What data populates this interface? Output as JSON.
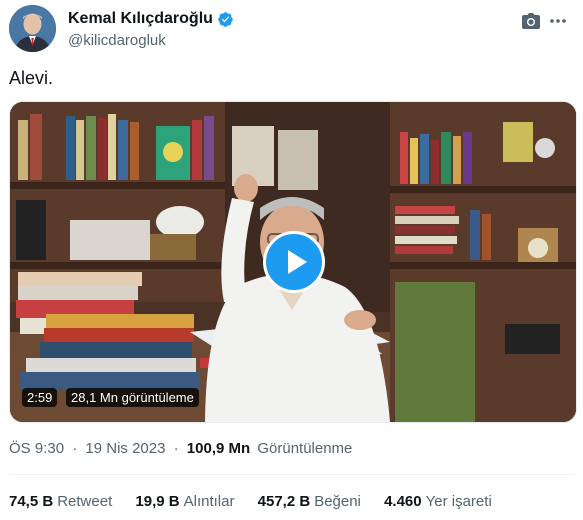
{
  "author": {
    "name": "Kemal Kılıçdaroğlu",
    "handle": "@kilicdarogluk"
  },
  "tweet": {
    "text": "Alevi."
  },
  "video": {
    "duration": "2:59",
    "views": "28,1 Mn görüntüleme"
  },
  "meta": {
    "time": "ÖS 9:30",
    "sep1": "·",
    "date": "19 Nis 2023",
    "sep2": "·",
    "views_count": "100,9 Mn",
    "views_label": "Görüntülenme"
  },
  "stats": [
    {
      "count": "74,5 B",
      "label": "Retweet"
    },
    {
      "count": "19,9 B",
      "label": "Alıntılar"
    },
    {
      "count": "457,2 B",
      "label": "Beğeni"
    },
    {
      "count": "4.460",
      "label": "Yer işareti"
    }
  ],
  "colors": {
    "accent": "#1d9bf0",
    "text": "#0f1419",
    "secondary": "#536471"
  },
  "icons": {
    "verified": "verified-badge-icon",
    "camera": "camera-icon",
    "more": "more-options-icon",
    "play": "play-icon"
  }
}
